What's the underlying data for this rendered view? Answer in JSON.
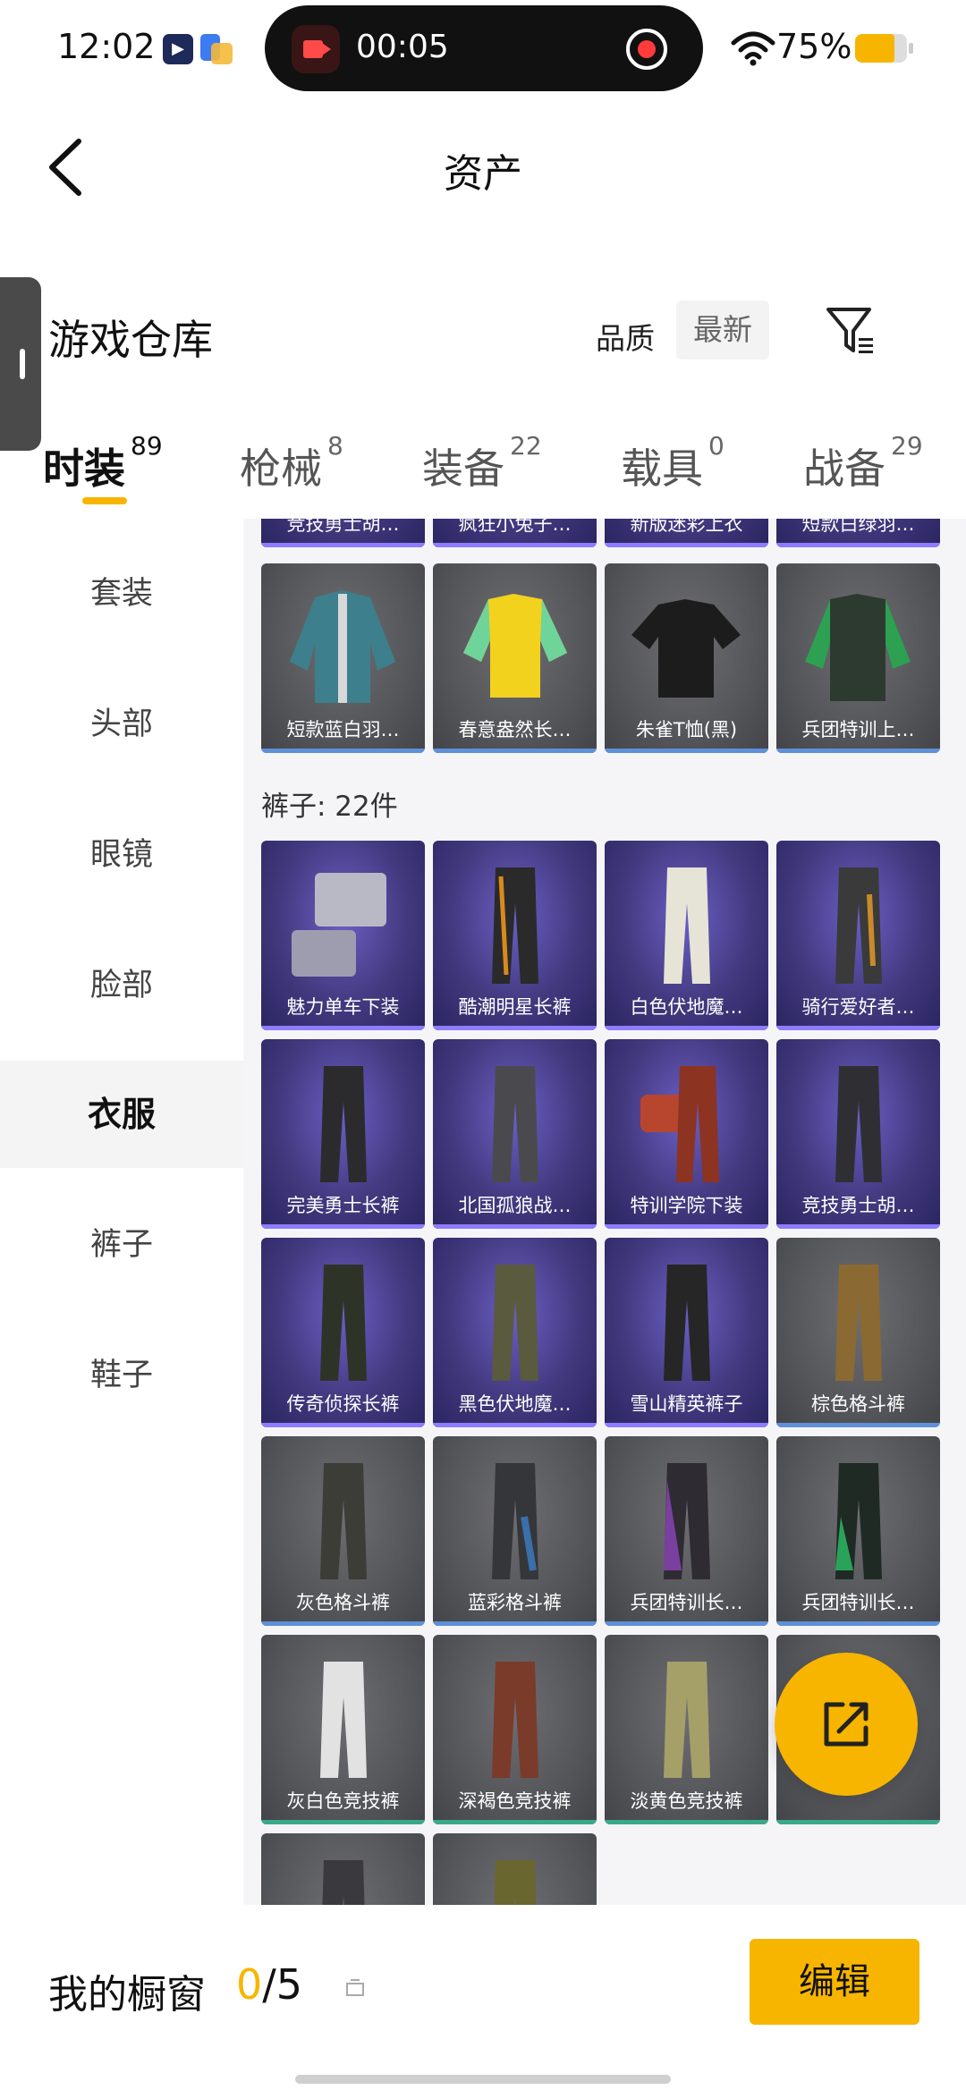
{
  "status_bar": {
    "time": "12:02",
    "recording_time": "00:05",
    "battery": "75%",
    "colors": {
      "battery": "#f7b500",
      "record": "#ff4a4a"
    }
  },
  "header": {
    "title": "资产",
    "back_icon": "chevron-left-icon"
  },
  "toolbar": {
    "section_title": "游戏仓库",
    "quality_label": "品质",
    "sort_label": "最新",
    "filter_icon": "filter-icon"
  },
  "tabs": [
    {
      "label": "时装",
      "count": "89"
    },
    {
      "label": "枪械",
      "count": "8"
    },
    {
      "label": "装备",
      "count": "22"
    },
    {
      "label": "载具",
      "count": "0"
    },
    {
      "label": "战备",
      "count": "29"
    }
  ],
  "categories": [
    "套装",
    "头部",
    "眼镜",
    "脸部",
    "衣服",
    "裤子",
    "鞋子"
  ],
  "content": {
    "top_row_partial": [
      "竞技勇士胡…",
      "疯狂小兔子…",
      "新版迷彩上衣",
      "短款白绿羽…"
    ],
    "clothes_row": [
      "短款蓝白羽…",
      "春意盎然长…",
      "朱雀T恤(黑)",
      "兵团特训上…"
    ],
    "pants_heading": "裤子: 22件",
    "pants_rows": [
      [
        "魅力单车下装",
        "酷潮明星长裤",
        "白色伏地魔…",
        "骑行爱好者…"
      ],
      [
        "完美勇士长裤",
        "北国孤狼战…",
        "特训学院下装",
        "竞技勇士胡…"
      ],
      [
        "传奇侦探长裤",
        "黑色伏地魔…",
        "雪山精英裤子",
        "棕色格斗裤"
      ],
      [
        "灰色格斗裤",
        "蓝彩格斗裤",
        "兵团特训长…",
        "兵团特训长…"
      ],
      [
        "灰白色竞技裤",
        "深褐色竞技裤",
        "淡黄色竞技裤",
        ""
      ]
    ],
    "fab_icon": "share-icon"
  },
  "bottom": {
    "label": "我的橱窗",
    "count_current": "0",
    "count_total": "/5",
    "edit_label": "编辑",
    "accent_color": "#f7b500"
  }
}
